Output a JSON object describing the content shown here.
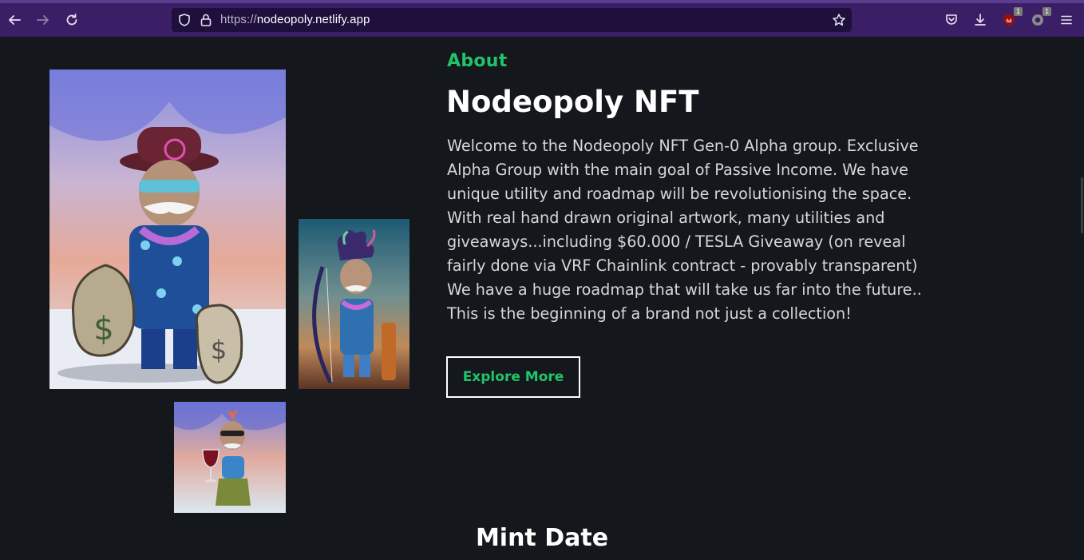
{
  "browser": {
    "url_scheme": "https://",
    "url_host": "nodeopoly.netlify.app",
    "extension_badges": [
      "1",
      "1"
    ]
  },
  "about": {
    "label": "About",
    "title": "Nodeopoly NFT",
    "body": "Welcome to the Nodeopoly NFT Gen-0 Alpha group. Exclusive Alpha Group with the main goal of Passive Income. We have unique utility and roadmap will be revolutionising the space. With real hand drawn original artwork, many utilities and giveaways...including $60.000 / TESLA Giveaway (on reveal fairly done via VRF Chainlink contract - provably transparent) We have a huge roadmap that will take us far into the future.. This is the beginning of a brand not just a collection!",
    "cta_label": "Explore More"
  },
  "mint": {
    "title": "Mint Date"
  },
  "colors": {
    "accent": "#21c46b",
    "background": "#14171b",
    "toolbar": "#3a1f66"
  }
}
